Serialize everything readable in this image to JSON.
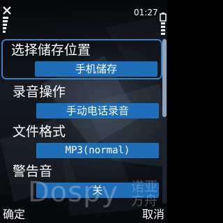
{
  "status_bar": {
    "time": "01:27",
    "close_icon": "close-icon",
    "signal_icon": "signal-strength-icon",
    "battery_icon": "battery-icon"
  },
  "settings": {
    "items": [
      {
        "label": "选择储存位置",
        "value": "手机储存",
        "selected": true
      },
      {
        "label": "录音操作",
        "value": "手动电话录音",
        "selected": false
      },
      {
        "label": "文件格式",
        "value": "MP3(normal)",
        "selected": false
      },
      {
        "label": "警告音",
        "value": "关",
        "selected": false
      }
    ]
  },
  "watermark": {
    "brand": "Dospy",
    "brand_cn": "诺亚方舟"
  },
  "softkeys": {
    "left": "确定",
    "right": "取消"
  },
  "colors": {
    "accent": "#1f6fb8",
    "selection_border": "#3f7fc0",
    "background": "#0e1217"
  }
}
